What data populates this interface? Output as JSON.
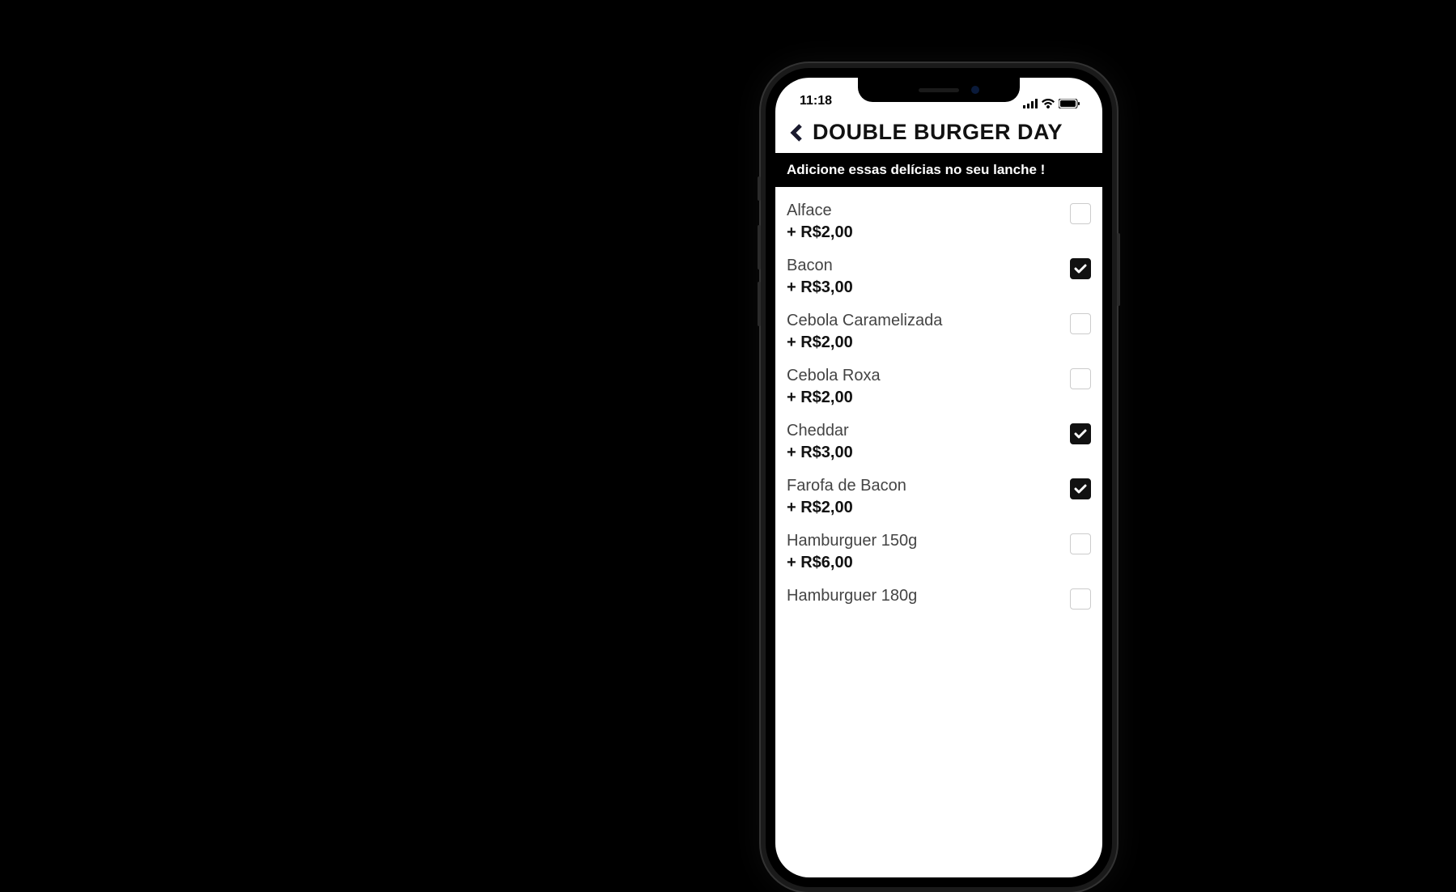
{
  "statusBar": {
    "time": "11:18"
  },
  "header": {
    "title": "DOUBLE BURGER DAY"
  },
  "section": {
    "title": "Adicione essas delícias no seu lanche !"
  },
  "items": [
    {
      "name": "Alface",
      "price": "+ R$2,00",
      "checked": false
    },
    {
      "name": "Bacon",
      "price": "+ R$3,00",
      "checked": true
    },
    {
      "name": "Cebola Caramelizada",
      "price": "+ R$2,00",
      "checked": false
    },
    {
      "name": "Cebola Roxa",
      "price": "+ R$2,00",
      "checked": false
    },
    {
      "name": "Cheddar",
      "price": "+ R$3,00",
      "checked": true
    },
    {
      "name": "Farofa de Bacon",
      "price": "+ R$2,00",
      "checked": true
    },
    {
      "name": "Hamburguer 150g",
      "price": "+ R$6,00",
      "checked": false
    },
    {
      "name": "Hamburguer 180g",
      "price": "",
      "checked": false
    }
  ]
}
